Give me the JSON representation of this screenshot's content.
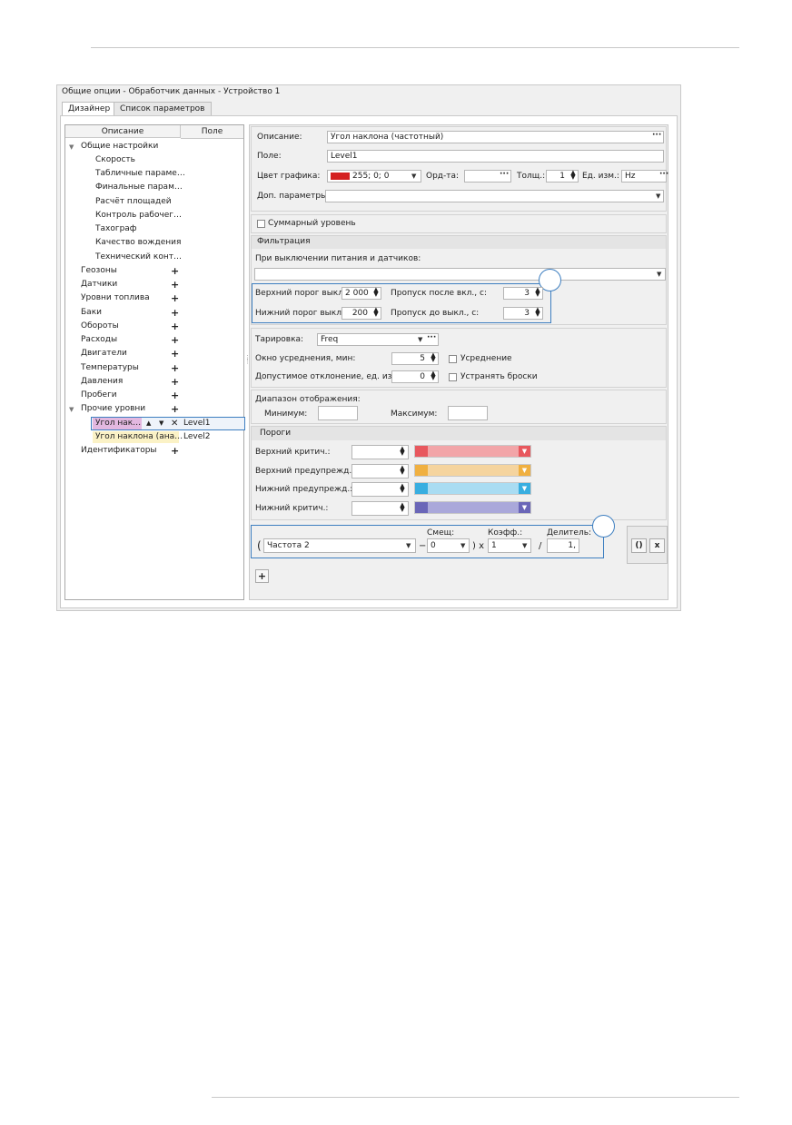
{
  "window": {
    "title": "Общие опции - Обработчик данных - Устройство 1"
  },
  "tabs": [
    {
      "label": "Дизайнер",
      "active": true
    },
    {
      "label": "Список параметров",
      "active": false
    }
  ],
  "tree": {
    "header": {
      "desc": "Описание",
      "field": "Поле"
    },
    "general": "Общие настройки",
    "general_children": [
      "Скорость",
      "Табличные параме…",
      "Финальные парам…",
      "Расчёт площадей",
      "Контроль рабочег…",
      "Тахограф",
      "Качество вождения",
      "Технический конт…"
    ],
    "groups": [
      "Геозоны",
      "Датчики",
      "Уровни топлива",
      "Баки",
      "Обороты",
      "Расходы",
      "Двигатели",
      "Температуры",
      "Давления",
      "Пробеги"
    ],
    "other_levels": "Прочие уровни",
    "sel_item": {
      "label": "Угол нак…",
      "field": "Level1"
    },
    "item2": {
      "label": "Угол наклона (ана…",
      "field": "Level2"
    },
    "identifiers": "Идентификаторы",
    "plus": "+",
    "up": "▲",
    "down": "▼",
    "remove": "✕"
  },
  "props": {
    "desc_label": "Описание:",
    "desc_value": "Угол наклона (частотный)",
    "field_label": "Поле:",
    "field_value": "Level1",
    "color_label": "Цвет графика:",
    "color_value": "255; 0; 0",
    "color_hex": "#d42020",
    "ord_label": "Орд-та:",
    "thick_label": "Толщ.:",
    "thick_value": "1",
    "unit_label": "Ед. изм.:",
    "unit_value": "Hz",
    "extra_label": "Доп. параметры:",
    "dots": "···",
    "dd_arrow": "▼"
  },
  "sum_level": "Суммарный уровень",
  "filtration": {
    "title": "Фильтрация",
    "power_off": "При выключении питания и датчиков:",
    "upper_off_label": "Верхний порог выкл.:",
    "upper_off_value": "2 000",
    "skip_after_label": "Пропуск после вкл., с:",
    "skip_after_value": "3",
    "lower_off_label": "Нижний порог выкл.:",
    "lower_off_value": "200",
    "skip_before_label": "Пропуск до выкл., с:",
    "skip_before_value": "3"
  },
  "calibration": {
    "label": "Тарировка:",
    "value": "Freq",
    "avg_window_label": "Окно усреднения, мин:",
    "avg_window_value": "5",
    "avg_label": "Усреднение",
    "deviation_label": "Допустимое отклонение, ед. изм.:",
    "deviation_value": "0",
    "spikes_label": "Устранять броски"
  },
  "range": {
    "title": "Диапазон отображения:",
    "min_label": "Минимум:",
    "max_label": "Максимум:"
  },
  "thresholds": {
    "title": "Пороги",
    "rows": [
      {
        "label": "Верхний критич.:",
        "color": "#f2a5a8",
        "accent": "#e8585e"
      },
      {
        "label": "Верхний предупрежд.:",
        "color": "#f5d49e",
        "accent": "#f0b040"
      },
      {
        "label": "Нижний предупрежд.:",
        "color": "#a9dcf2",
        "accent": "#38aee0"
      },
      {
        "label": "Нижний критич.:",
        "color": "#aaa8da",
        "accent": "#6a66b8"
      }
    ]
  },
  "formula": {
    "open": "(",
    "source": "Частота 2",
    "minus": "−",
    "offset_label": "Смещ:",
    "offset_value": "0",
    "close_mul": ") x",
    "coef_label": "Коэфф.:",
    "coef_value": "1",
    "slash": "/",
    "divider_label": "Делитель:",
    "divider_value": "1,",
    "parens_btn": "()",
    "remove_btn": "x",
    "add_btn": "+"
  }
}
